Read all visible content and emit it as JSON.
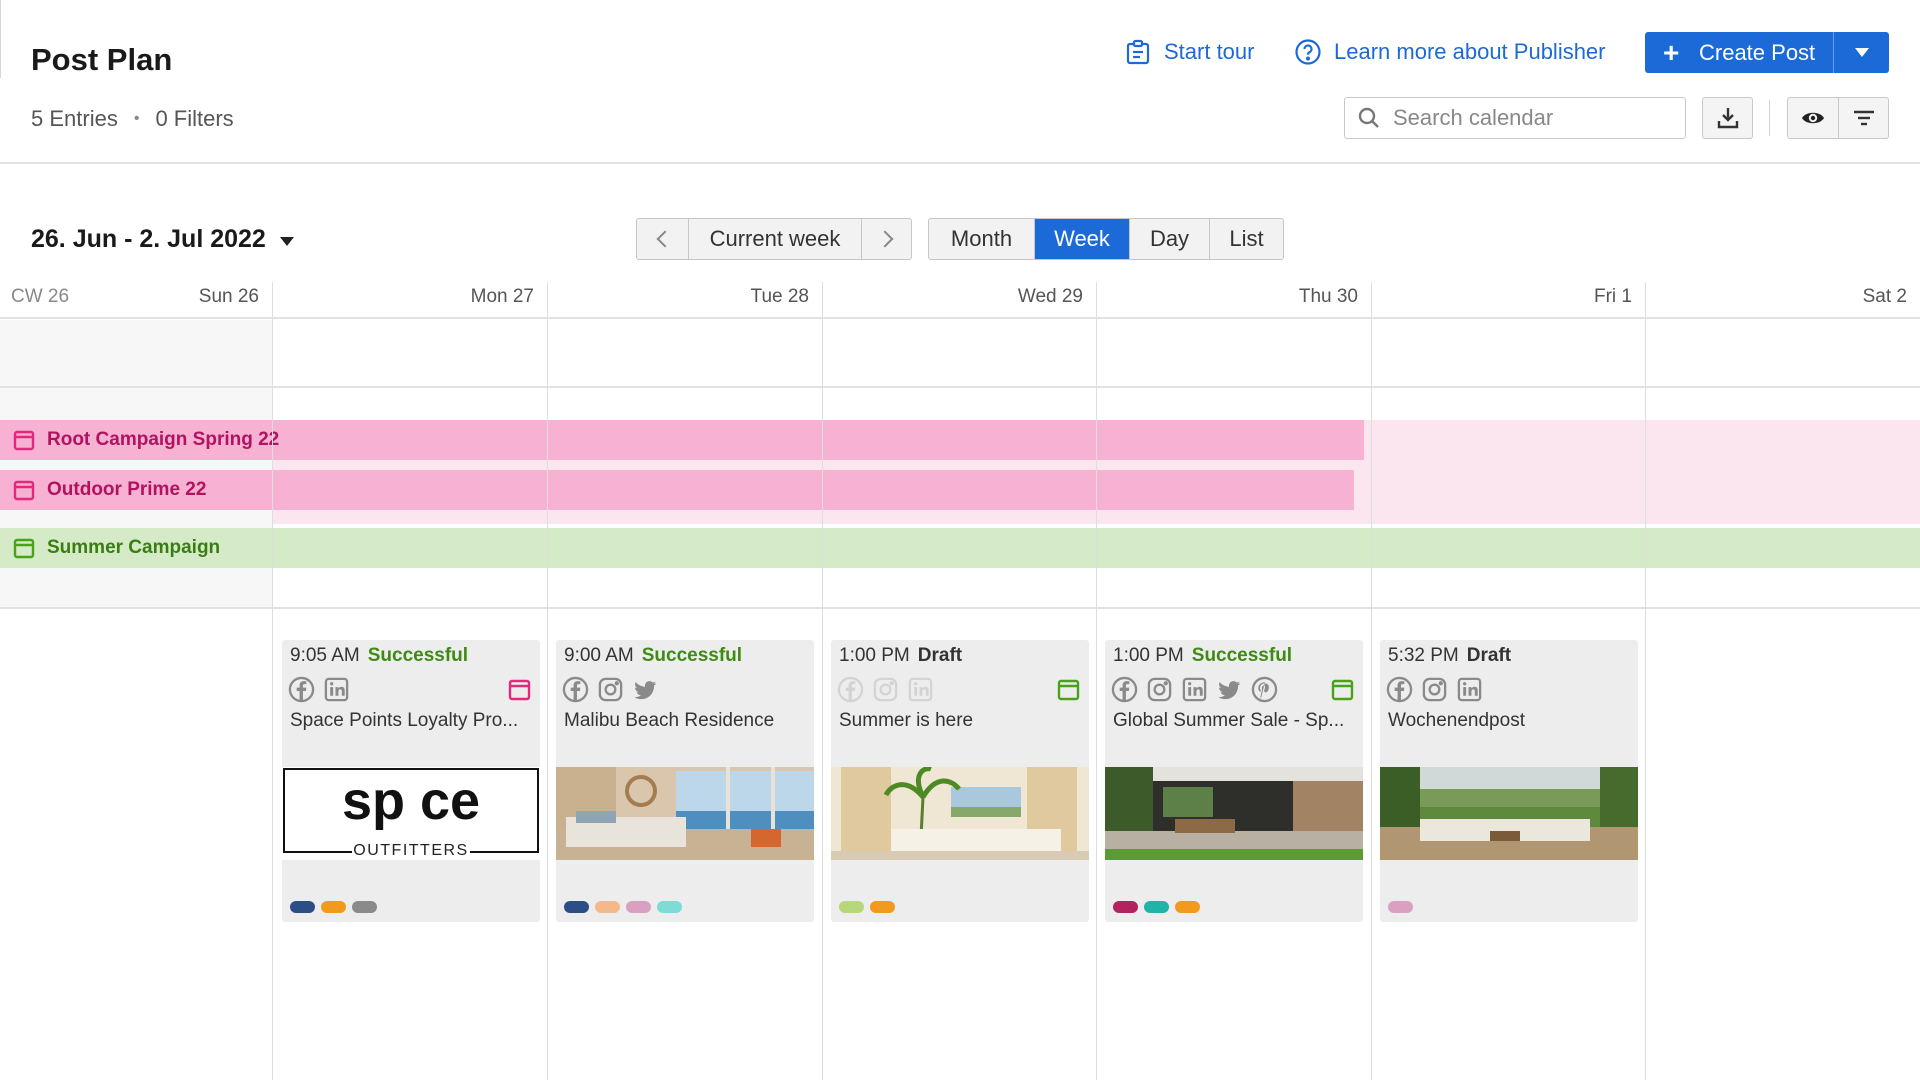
{
  "header": {
    "title": "Post Plan",
    "entries": "5 Entries",
    "filters": "0 Filters",
    "start_tour": "Start tour",
    "learn_more": "Learn more about Publisher",
    "create_post": "Create Post",
    "search_placeholder": "Search calendar"
  },
  "toolbar": {
    "date_range": "26. Jun - 2. Jul 2022",
    "current_week": "Current week",
    "views": [
      "Month",
      "Week",
      "Day",
      "List"
    ],
    "active_view": "Week"
  },
  "calendar": {
    "week_label": "CW 26",
    "days": [
      "Sun 26",
      "Mon 27",
      "Tue 28",
      "Wed 29",
      "Thu 30",
      "Fri 1",
      "Sat 2"
    ]
  },
  "campaigns": [
    {
      "name": "Root Campaign Spring 22",
      "color": "#f7b1d2",
      "text_color": "#b0135f"
    },
    {
      "name": "Outdoor Prime 22",
      "color": "#f7b1d2",
      "text_color": "#b0135f"
    },
    {
      "name": "Summer Campaign",
      "color": "#d5ebc8",
      "text_color": "#3a7d12"
    }
  ],
  "posts": [
    {
      "time": "9:05 AM",
      "status": "Successful",
      "networks": [
        "facebook-icon",
        "linkedin-icon"
      ],
      "title": "Space Points Loyalty Pro...",
      "image_text": "sp ce",
      "image_subtext": "OUTFITTERS",
      "tags": [
        "#2c4e86",
        "#f29a1c",
        "#8a8a8a"
      ],
      "flag_color": "#e4287d"
    },
    {
      "time": "9:00 AM",
      "status": "Successful",
      "networks": [
        "facebook-icon",
        "instagram-icon",
        "twitter-icon"
      ],
      "title": "Malibu Beach Residence",
      "tags": [
        "#2c4e86",
        "#f3b98a",
        "#d9a0c2",
        "#7edbd6"
      ]
    },
    {
      "time": "1:00 PM",
      "status": "Draft",
      "networks": [
        "facebook-icon",
        "instagram-icon",
        "linkedin-icon"
      ],
      "title": "Summer is here",
      "tags": [
        "#b6d77a",
        "#f29a1c"
      ],
      "flag_color": "#4aa21b"
    },
    {
      "time": "1:00 PM",
      "status": "Successful",
      "networks": [
        "facebook-icon",
        "instagram-icon",
        "linkedin-icon",
        "twitter-icon",
        "pinterest-icon"
      ],
      "title": "Global Summer Sale - Sp...",
      "tags": [
        "#b3245e",
        "#1fb3a9",
        "#f29a1c"
      ],
      "flag_color": "#4aa21b"
    },
    {
      "time": "5:32 PM",
      "status": "Draft",
      "networks": [
        "facebook-icon",
        "instagram-icon",
        "linkedin-icon"
      ],
      "title": "Wochenendpost",
      "tags": [
        "#d9a0c2"
      ]
    }
  ]
}
